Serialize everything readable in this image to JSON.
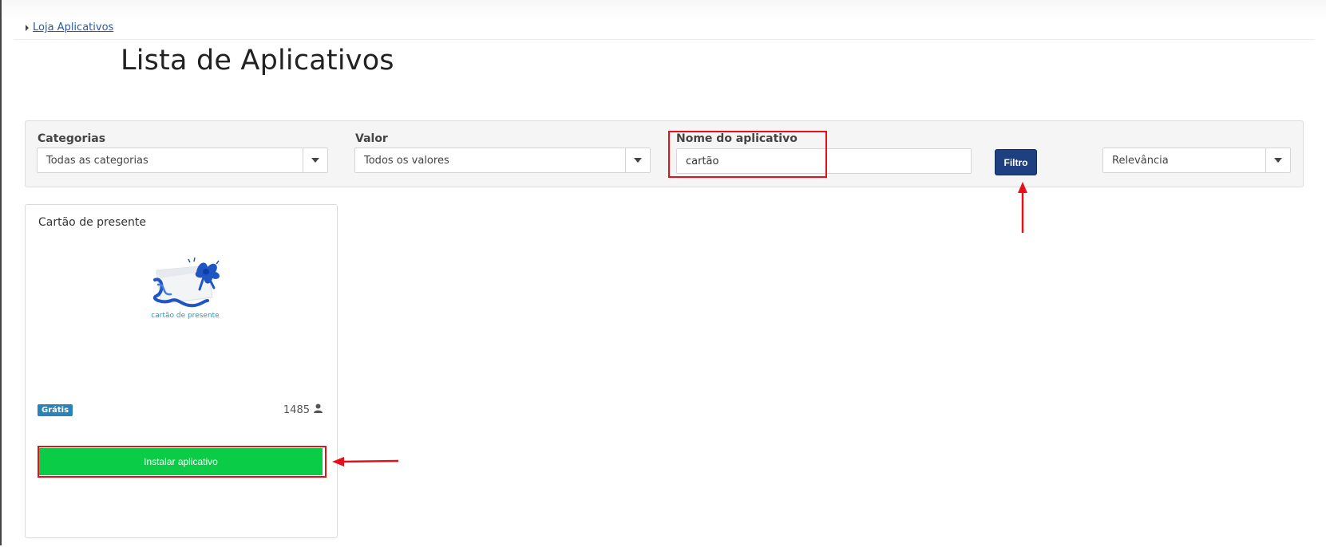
{
  "breadcrumb": {
    "link": "Loja Aplicativos"
  },
  "page": {
    "title": "Lista de Aplicativos"
  },
  "filters": {
    "categories": {
      "label": "Categorias",
      "selected": "Todas as categorias"
    },
    "value": {
      "label": "Valor",
      "selected": "Todos os valores"
    },
    "app_name": {
      "label": "Nome do aplicativo",
      "value": "cartão"
    },
    "filter_button": "Filtro",
    "sort": {
      "selected": "Relevância"
    }
  },
  "apps": [
    {
      "name": "Cartão de presente",
      "image_caption": "cartão de presente",
      "price_badge": "Grátis",
      "install_count": "1485",
      "install_button": "Instalar aplicativo"
    }
  ],
  "colors": {
    "accent_blue": "#1e3f80",
    "install_green": "#0bcc47",
    "badge_blue": "#2a83b8",
    "annotation_red": "#e4101a"
  },
  "icons": {
    "breadcrumb": "caret-right-icon",
    "dropdown": "chevron-down-icon",
    "users": "user-icon",
    "gift_card": "gift-card-ribbon-icon"
  }
}
